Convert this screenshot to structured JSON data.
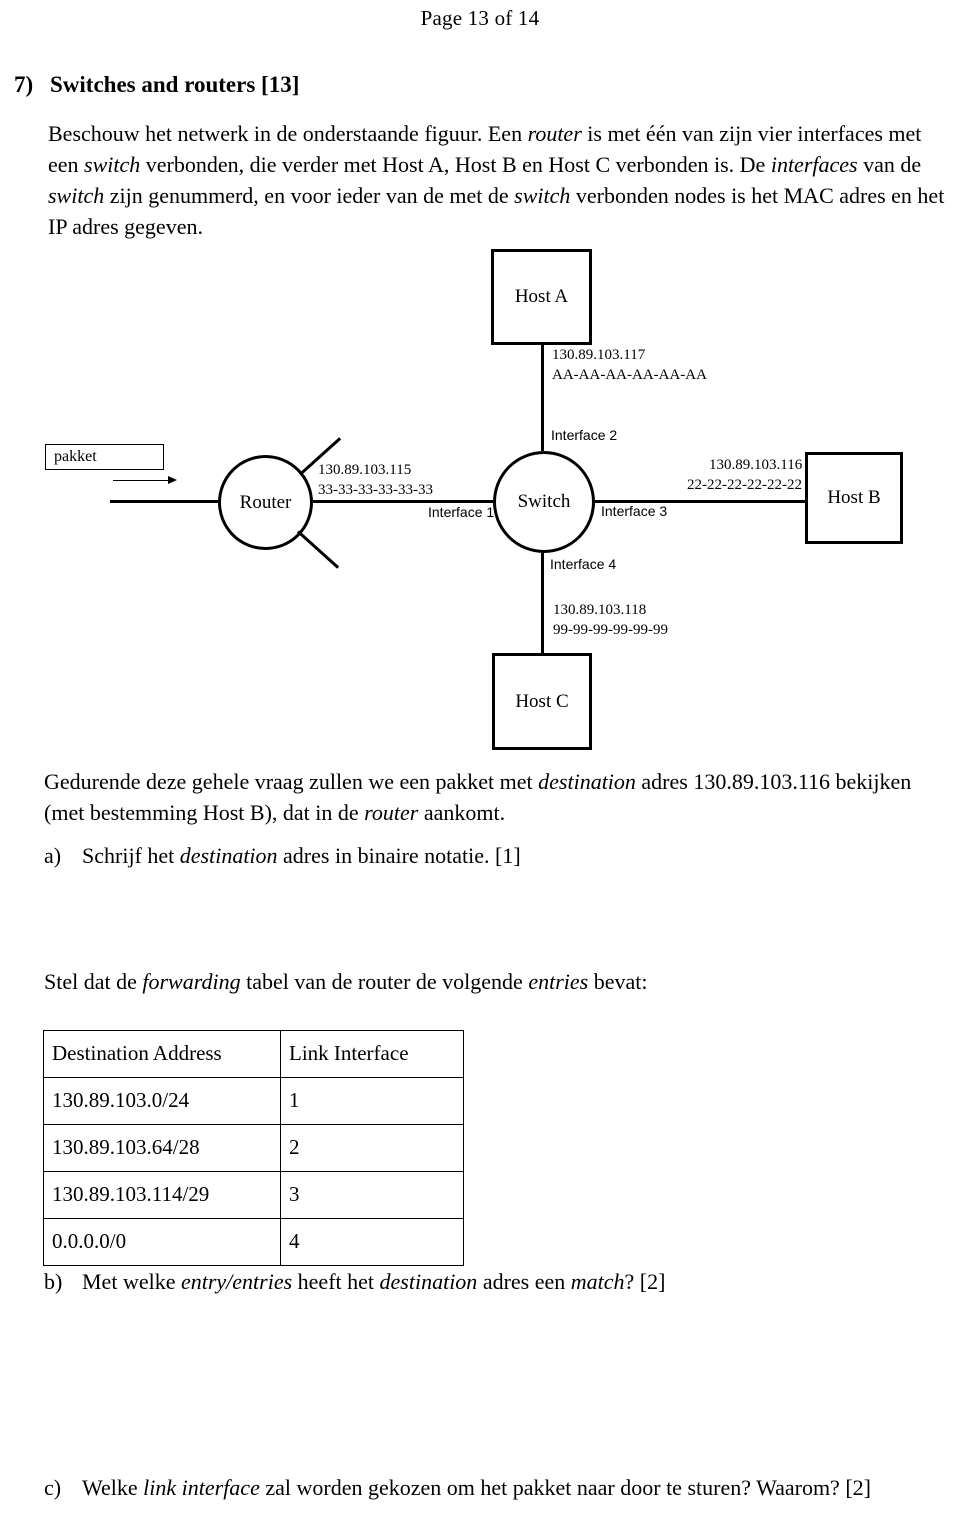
{
  "header": {
    "page_label": "Page 13 of 14"
  },
  "question": {
    "number": "7)",
    "title": "Switches and routers [13]",
    "intro_html": "Beschouw het netwerk in de onderstaande figuur. Een <i>router</i> is met één van zijn vier interfaces met een <i>switch</i> verbonden, die verder met Host A, Host B en Host C verbonden is. De <i>interfaces</i> van de <i>switch</i> zijn genummerd, en voor ieder van de met de <i>switch</i> verbonden nodes is het MAC adres en het IP adres gegeven."
  },
  "diagram": {
    "packet_label": "pakket",
    "router_label": "Router",
    "switch_label": "Switch",
    "host_a_label": "Host A",
    "host_b_label": "Host B",
    "host_c_label": "Host C",
    "router_ip": "130.89.103.115",
    "router_mac": "33-33-33-33-33-33",
    "host_a_ip": "130.89.103.117",
    "host_a_mac": "AA-AA-AA-AA-AA-AA",
    "host_b_ip": "130.89.103.116",
    "host_b_mac": "22-22-22-22-22-22",
    "host_c_ip": "130.89.103.118",
    "host_c_mac": "99-99-99-99-99-99",
    "interface_1": "Interface 1",
    "interface_2": "Interface 2",
    "interface_3": "Interface 3",
    "interface_4": "Interface 4"
  },
  "body": {
    "paragraph_1_html": "Gedurende deze gehele vraag zullen we een pakket met <i>destination</i> adres 130.89.103.116 bekijken (met bestemming Host B), dat in de <i>router</i> aankomt.",
    "item_a_mark": "a)",
    "item_a_html": "Schrijf het <i>destination</i> adres in binaire notatie. [1]",
    "paragraph_2_html": "Stel dat de <i>forwarding</i> tabel van de router de volgende <i>entries</i> bevat:",
    "item_b_mark": "b)",
    "item_b_html": "Met welke <i>entry/entries</i> heeft het <i>destination</i> adres een <i>match</i>? [2]",
    "item_c_mark": "c)",
    "item_c_html": "Welke <i>link interface</i> zal worden gekozen om het pakket naar door te sturen? Waarom? [2]"
  },
  "forwarding_table": {
    "columns": [
      "Destination Address",
      "Link Interface"
    ],
    "rows": [
      [
        "130.89.103.0/24",
        "1"
      ],
      [
        "130.89.103.64/28",
        "2"
      ],
      [
        "130.89.103.114/29",
        "3"
      ],
      [
        "0.0.0.0/0",
        "4"
      ]
    ]
  },
  "colors": {
    "ink": "#000000",
    "paper": "#ffffff"
  }
}
